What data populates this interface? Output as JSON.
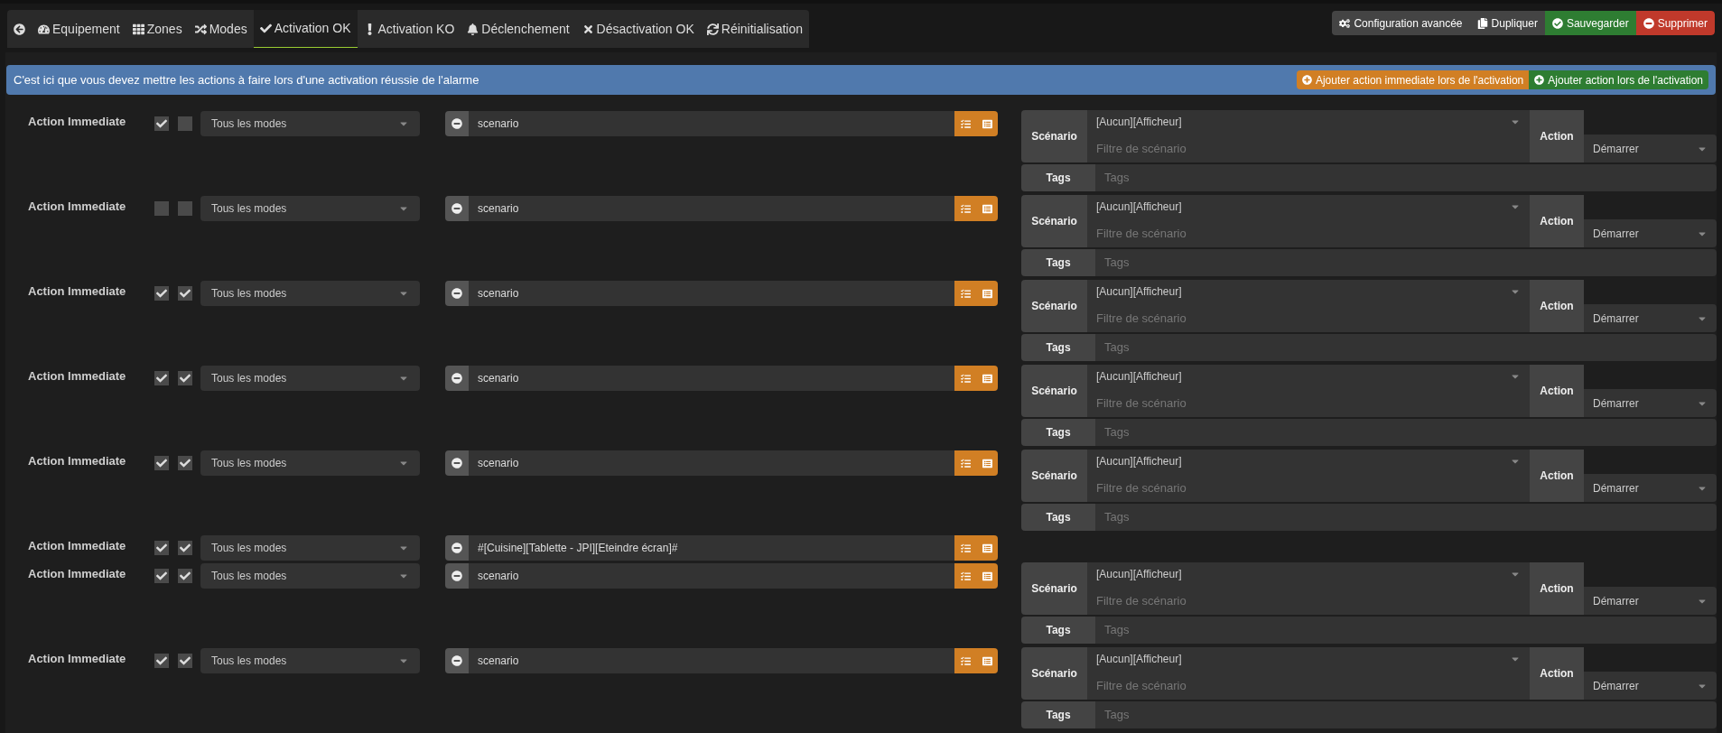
{
  "tabs": [
    {
      "kind": "back",
      "selected": false
    },
    {
      "label": "Equipement",
      "kind": "gauge",
      "selected": false
    },
    {
      "label": "Zones",
      "kind": "grid",
      "selected": false
    },
    {
      "label": "Modes",
      "kind": "modes",
      "selected": false
    },
    {
      "label": "Activation OK",
      "kind": "check",
      "selected": true
    },
    {
      "label": "Activation KO",
      "kind": "exclamation",
      "selected": false
    },
    {
      "label": "Déclenchement",
      "kind": "bell",
      "selected": false
    },
    {
      "label": "Désactivation OK",
      "kind": "times",
      "selected": false
    },
    {
      "label": "Réinitialisation",
      "kind": "sync",
      "selected": false
    }
  ],
  "toolbar": [
    {
      "label": "Configuration avancée",
      "kind": "config"
    },
    {
      "label": "Dupliquer",
      "kind": "copy"
    },
    {
      "label": "Sauvegarder",
      "kind": "save"
    },
    {
      "label": "Supprimer",
      "kind": "delete"
    }
  ],
  "banner": {
    "text": "C'est ici que vous devez mettre les actions à faire lors d'une activation réussie de l'alarme",
    "buttons": [
      {
        "label": "Ajouter action immediate lors de l'activation",
        "kind": "immediate"
      },
      {
        "label": "Ajouter action lors de l'activation",
        "kind": "normal"
      }
    ]
  },
  "actions": [
    {
      "label": "Action Immediate",
      "enabled": true,
      "parallel": false,
      "mode": "Tous les modes",
      "command": "scenario",
      "kind": "scenario",
      "scenario": "[Aucun][Afficheur]",
      "filter_placeholder": "Filtre de scénario",
      "scenario_label": "Scénario",
      "action_label": "Action",
      "action": "Démarrer",
      "tags_label": "Tags",
      "tags_placeholder": "Tags"
    },
    {
      "label": "Action Immediate",
      "enabled": false,
      "parallel": false,
      "mode": "Tous les modes",
      "command": "scenario",
      "kind": "scenario",
      "scenario": "[Aucun][Afficheur]",
      "filter_placeholder": "Filtre de scénario",
      "scenario_label": "Scénario",
      "action_label": "Action",
      "action": "Démarrer",
      "tags_label": "Tags",
      "tags_placeholder": "Tags"
    },
    {
      "label": "Action Immediate",
      "enabled": true,
      "parallel": true,
      "mode": "Tous les modes",
      "command": "scenario",
      "kind": "scenario",
      "scenario": "[Aucun][Afficheur]",
      "filter_placeholder": "Filtre de scénario",
      "scenario_label": "Scénario",
      "action_label": "Action",
      "action": "Démarrer",
      "tags_label": "Tags",
      "tags_placeholder": "Tags"
    },
    {
      "label": "Action Immediate",
      "enabled": true,
      "parallel": true,
      "mode": "Tous les modes",
      "command": "scenario",
      "kind": "scenario",
      "scenario": "[Aucun][Afficheur]",
      "filter_placeholder": "Filtre de scénario",
      "scenario_label": "Scénario",
      "action_label": "Action",
      "action": "Démarrer",
      "tags_label": "Tags",
      "tags_placeholder": "Tags"
    },
    {
      "label": "Action Immediate",
      "enabled": true,
      "parallel": true,
      "mode": "Tous les modes",
      "command": "scenario",
      "kind": "scenario",
      "scenario": "[Aucun][Afficheur]",
      "filter_placeholder": "Filtre de scénario",
      "scenario_label": "Scénario",
      "action_label": "Action",
      "action": "Démarrer",
      "tags_label": "Tags",
      "tags_placeholder": "Tags"
    },
    {
      "label": "Action Immediate",
      "enabled": true,
      "parallel": true,
      "mode": "Tous les modes",
      "command": "#[Cuisine][Tablette - JPI][Eteindre écran]#",
      "kind": "command"
    },
    {
      "label": "Action Immediate",
      "enabled": true,
      "parallel": true,
      "mode": "Tous les modes",
      "command": "scenario",
      "kind": "scenario",
      "scenario": "[Aucun][Afficheur]",
      "filter_placeholder": "Filtre de scénario",
      "scenario_label": "Scénario",
      "action_label": "Action",
      "action": "Démarrer",
      "tags_label": "Tags",
      "tags_placeholder": "Tags"
    },
    {
      "label": "Action Immediate",
      "enabled": true,
      "parallel": true,
      "mode": "Tous les modes",
      "command": "scenario",
      "kind": "scenario",
      "scenario": "[Aucun][Afficheur]",
      "filter_placeholder": "Filtre de scénario",
      "scenario_label": "Scénario",
      "action_label": "Action",
      "action": "Démarrer",
      "tags_label": "Tags",
      "tags_placeholder": "Tags"
    }
  ]
}
